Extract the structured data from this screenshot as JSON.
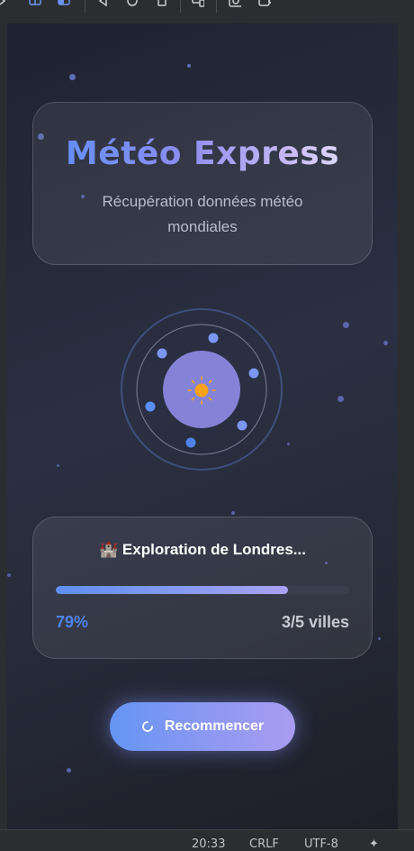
{
  "app": {
    "title": "Météo Express",
    "subtitle": "Récupération données météo mondiales"
  },
  "loader": {
    "center_icon": "sun-icon"
  },
  "progress": {
    "status_text": "🏰 Exploration de Londres...",
    "percent_label": "79%",
    "fraction": 0.79,
    "count_label": "3/5 villes"
  },
  "actions": {
    "restart_label": "Recommencer",
    "restart_icon": "refresh-icon"
  },
  "ide_statusbar": {
    "time": "20:33",
    "line_ending": "CRLF",
    "encoding": "UTF-8"
  },
  "colors": {
    "accent_blue": "#5b8ff5",
    "accent_violet": "#a99cf1",
    "percent": "#4f83ea",
    "sun": "#f6a21a"
  }
}
